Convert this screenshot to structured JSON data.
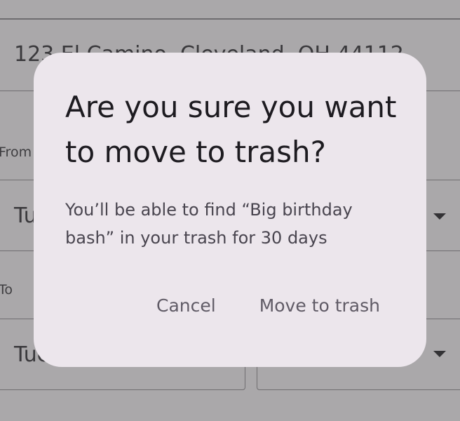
{
  "form": {
    "address_value": "123 El Camino, Cleveland, OH 44112",
    "from_label": "From",
    "from_date": "Tue",
    "to_label": "To",
    "to_date": "Tue"
  },
  "dialog": {
    "title": "Are you sure you want to move to trash?",
    "body": "You’ll be able to find “Big birthday bash” in your trash for 30 days",
    "cancel_label": "Cancel",
    "confirm_label": "Move to trash"
  },
  "colors": {
    "scrim": "#aaa8aa",
    "dialog_surface": "#ece6ec",
    "title_text": "#1d1b20",
    "body_text": "#49454f",
    "button_text": "#605b66"
  },
  "icons": {
    "dropdown": "arrow-drop-down-icon"
  }
}
